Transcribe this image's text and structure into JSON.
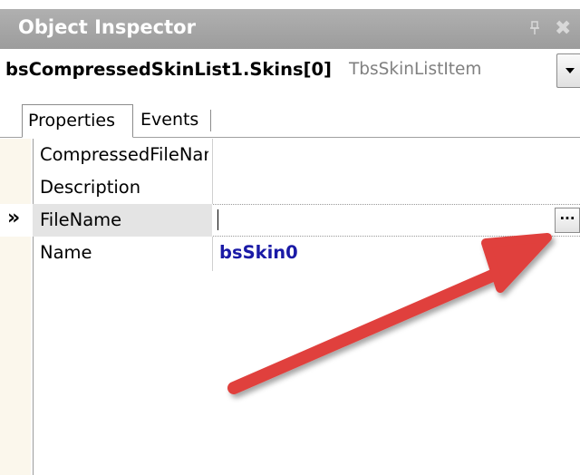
{
  "panel": {
    "title": "Object Inspector",
    "pin_icon": "pin-icon",
    "close_icon": "close-icon"
  },
  "selector": {
    "object_name": "bsCompressedSkinList1.Skins[0]",
    "object_type": "TbsSkinListItem"
  },
  "tabs": [
    {
      "label": "Properties"
    },
    {
      "label": "Events"
    }
  ],
  "current_row_marker": "»",
  "properties": [
    {
      "name": "CompressedFileName",
      "value": ""
    },
    {
      "name": "Description",
      "value": ""
    },
    {
      "name": "FileName",
      "value": ""
    },
    {
      "name": "Name",
      "value": "bsSkin0"
    }
  ],
  "ellipsis_label": "···",
  "colors": {
    "title_bar": "#a6a6a6",
    "value_text": "#1a1aa6",
    "arrow": "#e0403c"
  }
}
